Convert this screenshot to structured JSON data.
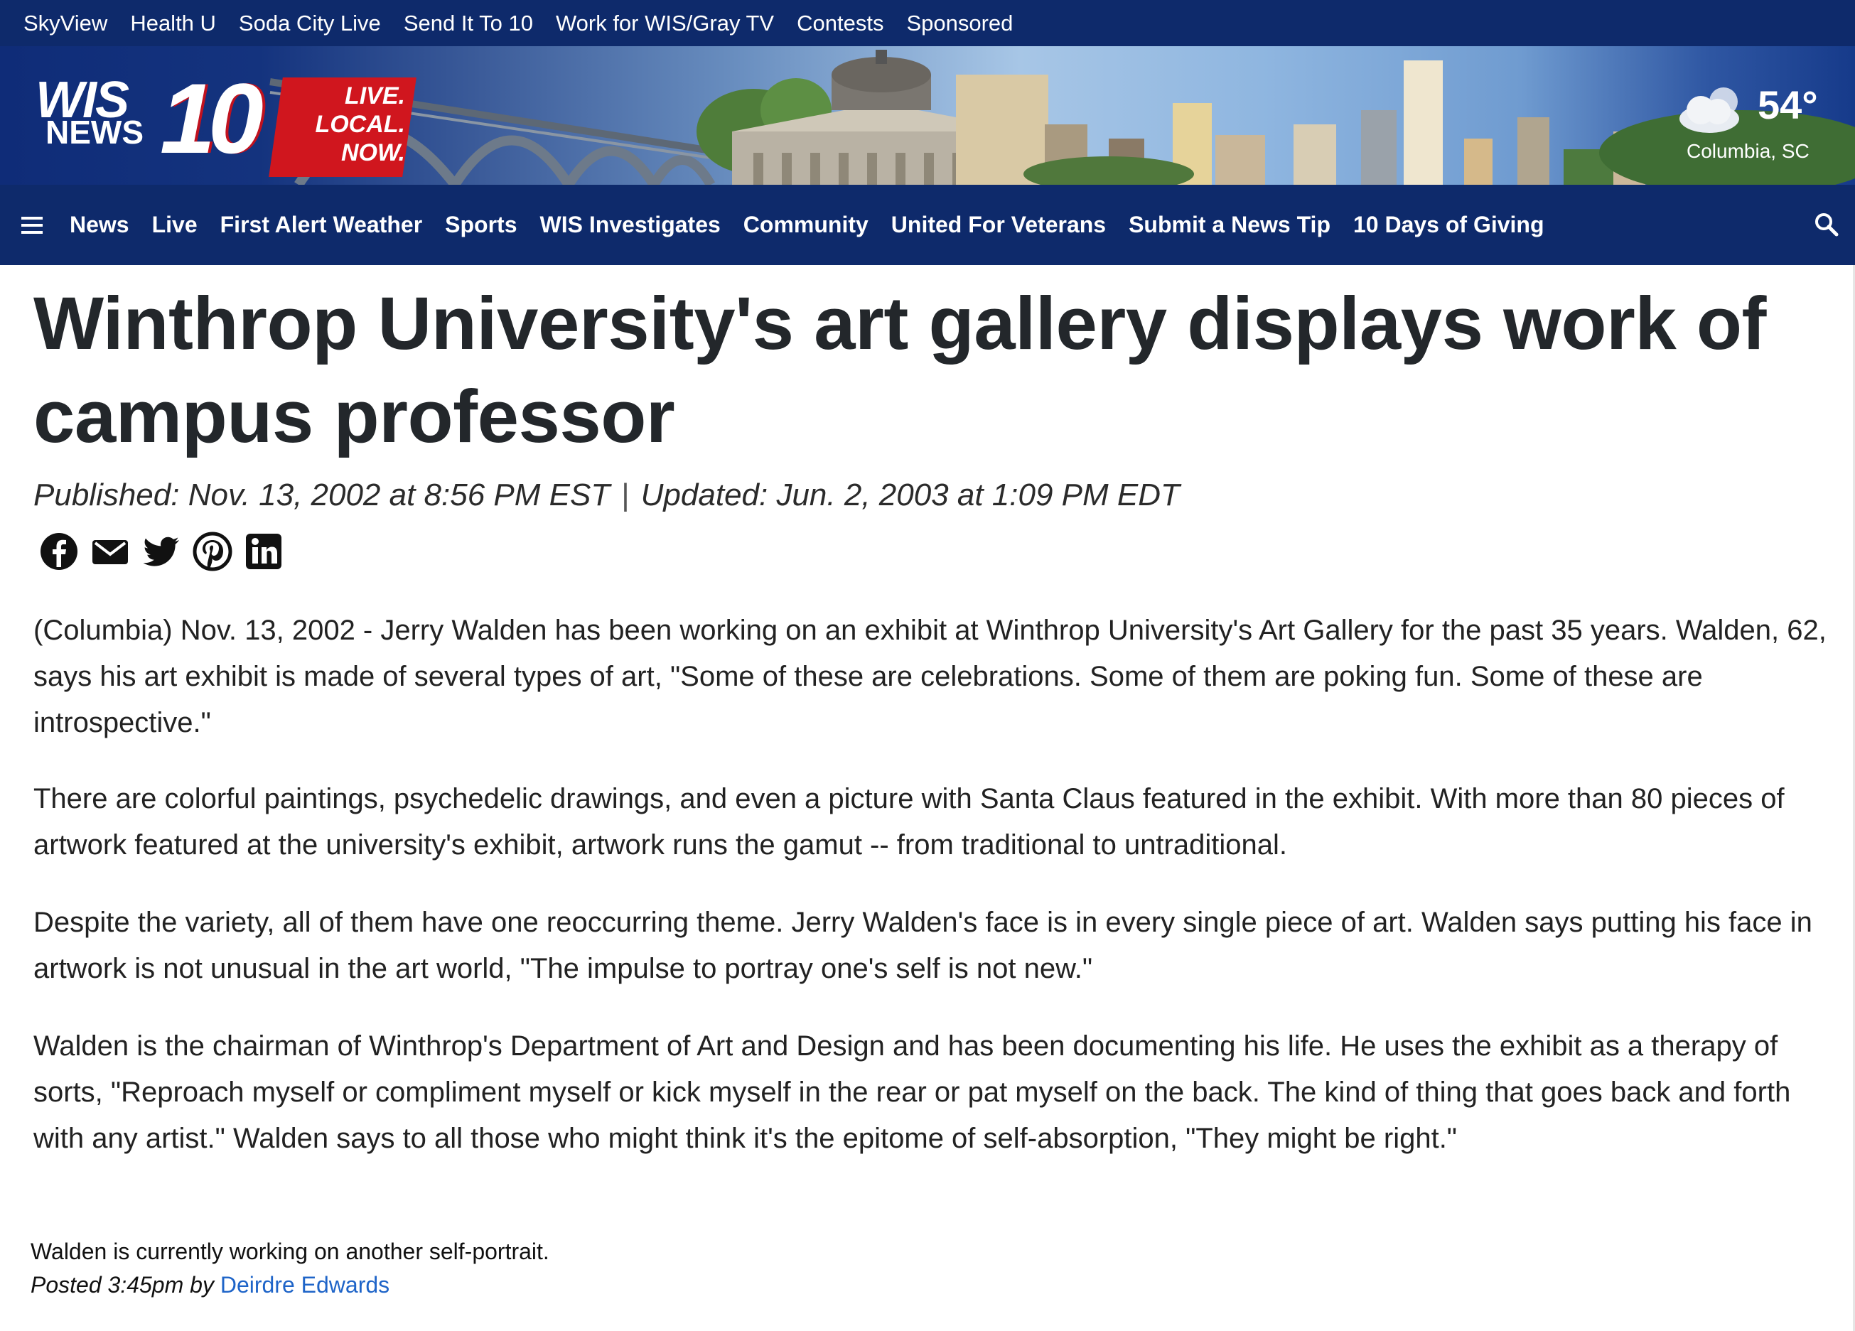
{
  "top_bar": {
    "links": [
      "SkyView",
      "Health U",
      "Soda City Live",
      "Send It To 10",
      "Work for WIS/Gray TV",
      "Contests",
      "Sponsored"
    ]
  },
  "banner": {
    "logo": {
      "wis": "WIS",
      "news": "NEWS",
      "number": "10",
      "tag1": "LIVE.",
      "tag2": "LOCAL.",
      "tag3": "NOW."
    },
    "weather": {
      "icon": "partly-cloudy-icon",
      "temperature": "54°",
      "location": "Columbia, SC"
    },
    "colors": {
      "navy": "#0e2a6b",
      "brand_red": "#d0161e"
    }
  },
  "main_nav": {
    "items": [
      "News",
      "Live",
      "First Alert Weather",
      "Sports",
      "WIS Investigates",
      "Community",
      "United For Veterans",
      "Submit a News Tip",
      "10 Days of Giving"
    ],
    "menu_icon": "hamburger-icon",
    "search_icon": "search-icon"
  },
  "article": {
    "headline": "Winthrop University's art gallery displays work of campus professor",
    "published": "Published: Nov. 13, 2002 at 8:56 PM EST",
    "separator": "|",
    "updated": "Updated: Jun. 2, 2003 at 1:09 PM EDT",
    "share_icons": [
      "facebook-icon",
      "email-icon",
      "twitter-icon",
      "pinterest-icon",
      "linkedin-icon"
    ],
    "paragraphs": [
      "(Columbia) Nov. 13, 2002 - Jerry Walden has been working on an exhibit at Winthrop University's Art Gallery for the past 35 years. Walden, 62, says his art exhibit is made of several types of art, \"Some of these are celebrations. Some of them are poking fun. Some of these are introspective.\"",
      "There are colorful paintings, psychedelic drawings, and even a picture with Santa Claus featured in the exhibit. With more than 80 pieces of artwork featured at the university's exhibit, artwork runs the gamut -- from traditional to untraditional.",
      "Despite the variety, all of them have one reoccurring theme. Jerry Walden's face is in every single piece of art. Walden says putting his face in artwork is not unusual in the art world, \"The impulse to portray one's self is not new.\"",
      "Walden is the chairman of Winthrop's Department of Art and Design and has been documenting his life. He uses the exhibit as a therapy of sorts, \"Reproach myself or compliment myself or kick myself in the rear or pat myself on the back. The kind of thing that goes back and forth with any artist.\" Walden says to all those who might think it's the epitome of self-absorption, \"They might be right.\""
    ],
    "footnote": "Walden is currently working on another self-portrait.",
    "posted_prefix": "Posted 3:45pm by ",
    "author": "Deirdre Edwards",
    "link_color": "#1e64c8"
  }
}
